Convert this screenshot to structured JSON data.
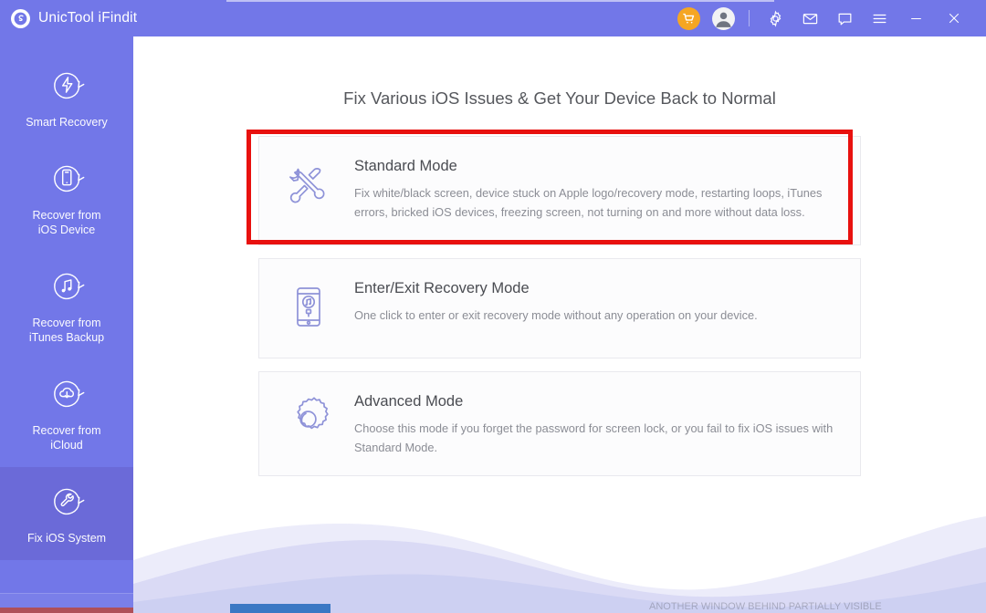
{
  "window": {
    "app_title": "UnicTool iFindit",
    "logo_icon": "hexagon-swirl-logo-icon",
    "titlebar_color": "#7277e8",
    "controls": [
      {
        "name": "cart-button",
        "icon": "shopping-cart-icon",
        "label": "Cart",
        "accent": "#f5a623"
      },
      {
        "name": "account-button",
        "icon": "user-avatar-icon",
        "label": "Account",
        "accent": "#f2f2f4"
      },
      {
        "name": "settings-button",
        "icon": "gear-icon",
        "label": "Settings",
        "accent": "#ffffff"
      },
      {
        "name": "mail-button",
        "icon": "envelope-icon",
        "label": "Mail",
        "accent": "#ffffff"
      },
      {
        "name": "feedback-button",
        "icon": "chat-bubble-icon",
        "label": "Feedback",
        "accent": "#ffffff"
      },
      {
        "name": "menu-button",
        "icon": "hamburger-menu-icon",
        "label": "Menu",
        "accent": "#ffffff"
      },
      {
        "name": "minimize-button",
        "icon": "minimize-icon",
        "label": "Minimize",
        "accent": "#ffffff"
      },
      {
        "name": "close-button",
        "icon": "close-icon",
        "label": "Close",
        "accent": "#ffffff"
      }
    ]
  },
  "sidebar": {
    "background_color": "#7277e8",
    "active_background_color": "#6b6ad8",
    "items": [
      {
        "label": "Smart Recovery",
        "icon": "smart-recovery-bolt-refresh-icon",
        "active": false
      },
      {
        "label": "Recover from\niOS Device",
        "icon": "recover-ios-device-phone-refresh-icon",
        "active": false
      },
      {
        "label": "Recover from\niTunes Backup",
        "icon": "recover-itunes-backup-music-refresh-icon",
        "active": false
      },
      {
        "label": "Recover from\niCloud",
        "icon": "recover-icloud-download-refresh-icon",
        "active": false
      },
      {
        "label": "Fix iOS System",
        "icon": "fix-ios-system-wrench-refresh-icon",
        "active": true
      }
    ]
  },
  "main": {
    "heading": "Fix Various iOS Issues & Get Your Device Back to Normal",
    "cards": [
      {
        "id": "standard-mode",
        "title": "Standard Mode",
        "description": "Fix white/black screen, device stuck on Apple logo/recovery mode, restarting loops, iTunes errors, bricked iOS devices, freezing screen, not turning on and more without data loss.",
        "icon": "wrench-screwdriver-icon",
        "highlighted": true
      },
      {
        "id": "enter-exit-recovery-mode",
        "title": "Enter/Exit Recovery Mode",
        "description": "One click to enter or exit recovery mode without any operation on your device.",
        "icon": "phone-itunes-cable-icon",
        "highlighted": false
      },
      {
        "id": "advanced-mode",
        "title": "Advanced Mode",
        "description": "Choose this mode if you forget the password for screen lock, or you fail to fix iOS issues with Standard Mode.",
        "icon": "gear-outline-icon",
        "highlighted": false
      }
    ]
  },
  "annotation": {
    "highlight_color": "#e8110f",
    "target": "standard-mode"
  },
  "artifacts": {
    "bottom_text": "ANOTHER WINDOW BEHIND PARTIALLY VISIBLE"
  }
}
